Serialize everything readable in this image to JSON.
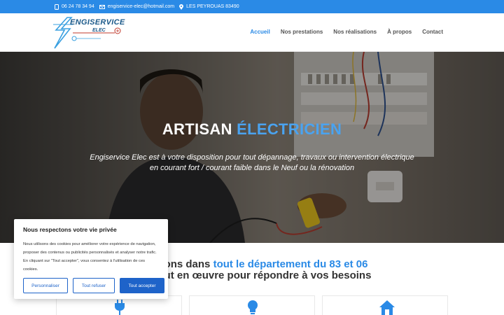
{
  "topbar": {
    "phone": "06 24 78 34 94",
    "email": "engiservice-elec@hotmail.com",
    "location": "LES PEYROUAS 83490"
  },
  "logo": {
    "name": "ENGISERVICE",
    "sub": "ELEC"
  },
  "nav": {
    "items": [
      "Accueil",
      "Nos prestations",
      "Nos réalisations",
      "À propos",
      "Contact"
    ],
    "active_index": 0
  },
  "hero": {
    "title_main": "ARTISAN",
    "title_accent": "ÉLECTRICIEN",
    "text_line1": "Engiservice Elec est à votre disposition pour tout dépannage, travaux ou intervention électrique",
    "text_line2": "en courant fort / courant faible dans le Neuf ou la rénovation"
  },
  "intro": {
    "line1_main": "ervenons dans",
    "line1_accent": "tout le département du 83 et 06",
    "line2": "ons tout en œuvre pour répondre à vos besoins"
  },
  "cookie": {
    "title": "Nous respectons votre vie privée",
    "text": "Nous utilisons des cookies pour améliorer votre expérience de navigation, proposer des contenus ou publicités personnalisés et analyser notre trafic. En cliquant sur \"Tout accepter\", vous consentez à l'utilisation de ces cookies.",
    "customize_label": "Personnaliser",
    "reject_label": "Tout refuser",
    "accept_label": "Tout accepter"
  },
  "colors": {
    "primary": "#2a8ae6",
    "accent_text": "#4aa3f0",
    "button_blue": "#1e63c9",
    "logo_blue": "#1c5a8a"
  },
  "icons": [
    "phone-icon",
    "mail-icon",
    "location-icon",
    "plug-icon",
    "bulb-icon",
    "house-icon"
  ]
}
